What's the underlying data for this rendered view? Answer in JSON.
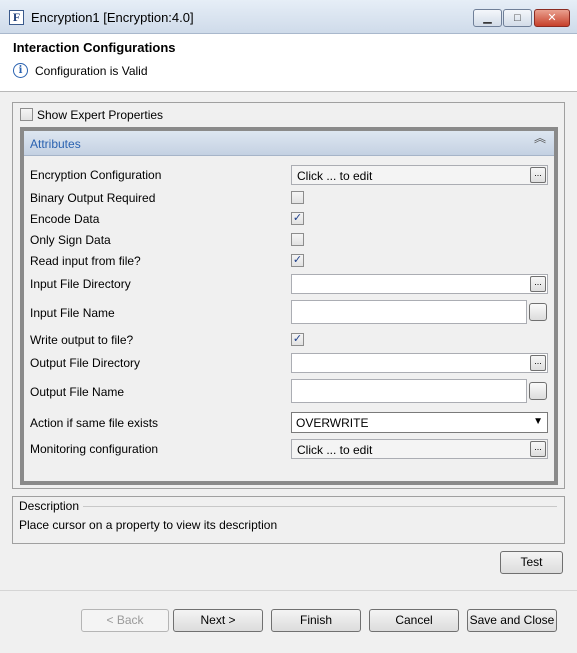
{
  "window": {
    "title": "Encryption1 [Encryption:4.0]",
    "app_icon_letter": "F",
    "min_glyph": "▁",
    "max_glyph": "□",
    "close_glyph": "✕"
  },
  "header": {
    "title": "Interaction Configurations",
    "status": "Configuration is Valid",
    "status_icon": "info-icon"
  },
  "expert": {
    "label": "Show Expert Properties",
    "checked": false
  },
  "attributes": {
    "title": "Attributes",
    "collapse_glyph": "︽",
    "properties": [
      {
        "label": "Encryption Configuration",
        "value": "Click ... to edit"
      },
      {
        "label": "Binary Output Required",
        "checked": false
      },
      {
        "label": "Encode Data",
        "checked": true
      },
      {
        "label": "Only Sign Data",
        "checked": false
      },
      {
        "label": "Read input from file?",
        "checked": true
      },
      {
        "label": "Input File Directory",
        "value": ""
      },
      {
        "label": "Input File Name",
        "value": ""
      },
      {
        "label": "Write output to file?",
        "checked": true
      },
      {
        "label": "Output File Directory",
        "value": ""
      },
      {
        "label": "Output File Name",
        "value": ""
      },
      {
        "label": "Action if same file exists",
        "value": "OVERWRITE"
      },
      {
        "label": "Monitoring configuration",
        "value": "Click ... to edit"
      }
    ],
    "ellipsis": "...",
    "check_glyph": "✓",
    "dropdown_glyph": "▼"
  },
  "description": {
    "title": "Description",
    "text": "Place cursor on a property to view its description"
  },
  "buttons": {
    "test": "Test",
    "back": "< Back",
    "next": "Next >",
    "finish": "Finish",
    "cancel": "Cancel",
    "save_close": "Save and Close"
  },
  "colors": {
    "accent": "#2a62b0",
    "close_button": "#c7402a"
  }
}
